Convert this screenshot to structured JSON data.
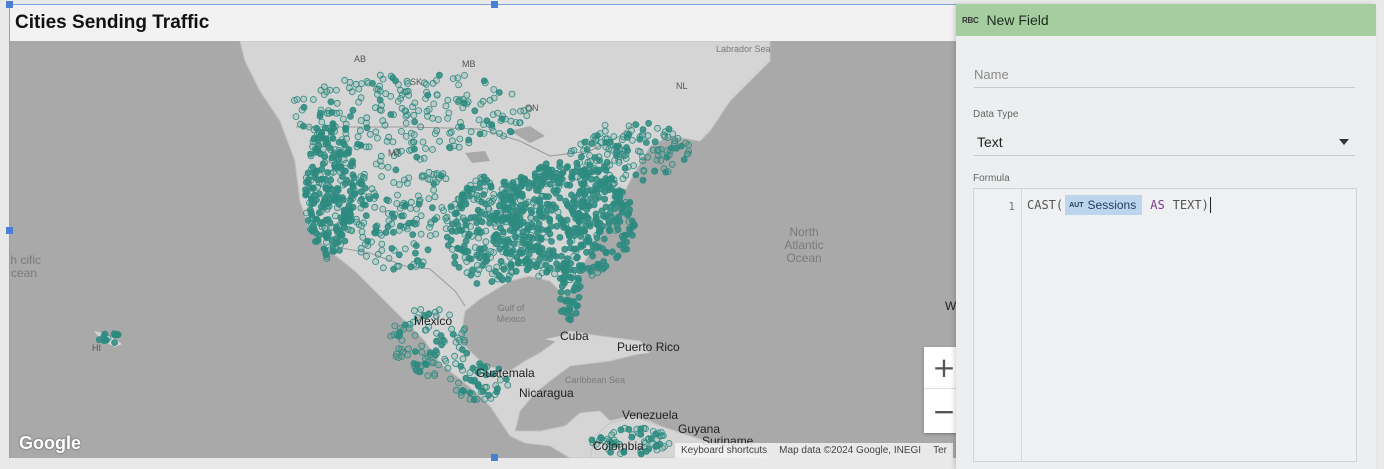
{
  "chart": {
    "title": "Cities Sending Traffic",
    "point_color": "#2e8b80",
    "zoom_in": "+",
    "zoom_out": "−",
    "google": "Google",
    "attribution": {
      "shortcuts": "Keyboard shortcuts",
      "map_data": "Map data ©2024 Google, INEGI",
      "terms": "Ter"
    },
    "labels": {
      "mexico": "Mexico",
      "cuba": "Cuba",
      "puerto_rico": "Puerto Rico",
      "guatemala": "Guatemala",
      "nicaragua": "Nicaragua",
      "venezuela": "Venezuela",
      "guyana": "Guyana",
      "suriname": "Suriname",
      "colombia": "Colombia",
      "gulf": "Gulf of Mexico",
      "caribbean": "Caribbean Sea",
      "north_atlantic": "North Atlantic Ocean",
      "pacific": "th cific cean",
      "labrador": "Labrador Sea",
      "on": "ON",
      "nl": "NL",
      "ab": "AB",
      "sk": "SK",
      "mb": "MB",
      "mt": "MT",
      "hi": "HI",
      "w": "W"
    }
  },
  "field_panel": {
    "title": "New Field",
    "type_icon": "RBC",
    "name_placeholder": "Name",
    "data_type_label": "Data Type",
    "data_type_value": "Text",
    "formula_label": "Formula",
    "line_number": "1",
    "formula": {
      "cast": "CAST(",
      "field_type_badge": "AUT",
      "field_name": "Sessions",
      "as": "AS",
      "text": "TEXT)"
    }
  }
}
